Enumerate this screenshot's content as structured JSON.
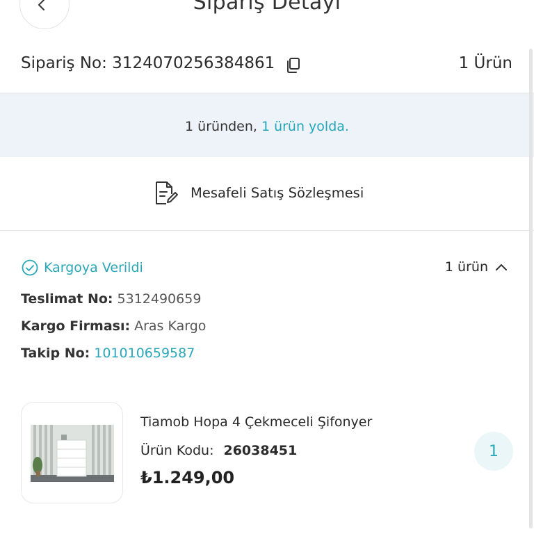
{
  "header": {
    "title": "Sipariş Detayı",
    "back_icon": "chevron-left-icon"
  },
  "order": {
    "label": "Sipariş No:",
    "number": "3124070256384861",
    "copy_icon": "copy-icon",
    "item_count": "1 Ürün"
  },
  "status_banner": {
    "text": "1 üründen,",
    "highlight": "1 ürün yolda.",
    "highlight_color": "#22a6b8"
  },
  "contract": {
    "icon": "document-edit-icon",
    "label": "Mesafeli Satış Sözleşmesi"
  },
  "shipment": {
    "status_icon": "check-circle-icon",
    "status": "Kargoya Verildi",
    "status_color": "#2aa7b8",
    "count": "1 ürün",
    "toggle_icon": "chevron-up-icon",
    "delivery_label": "Teslimat No:",
    "delivery_no": "5312490659",
    "carrier_label": "Kargo Firması:",
    "carrier": "Aras Kargo",
    "tracking_label": "Takip No:",
    "tracking_no": "101010659587"
  },
  "product": {
    "name": "Tiamob Hopa 4 Çekmeceli Şifonyer",
    "code_label": "Ürün Kodu:",
    "code": "26038451",
    "price": "₺1.249,00",
    "quantity": "1",
    "image_icon": "dresser-product-image"
  }
}
